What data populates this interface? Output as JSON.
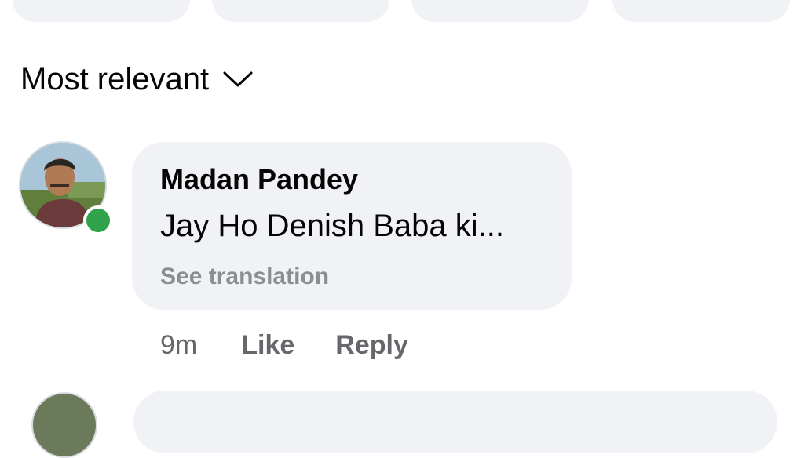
{
  "sort": {
    "label": "Most relevant",
    "icon": "chevron-down-icon"
  },
  "comment": {
    "author": "Madan Pandey",
    "text": "Jay Ho Denish Baba ki...",
    "translation_link": "See translation",
    "time": "9m",
    "like_label": "Like",
    "reply_label": "Reply",
    "online": true
  },
  "colors": {
    "bubble_bg": "#f0f2f5",
    "online_green": "#31a24c",
    "secondary_text": "#65676b",
    "muted_text": "#8a8d91"
  }
}
